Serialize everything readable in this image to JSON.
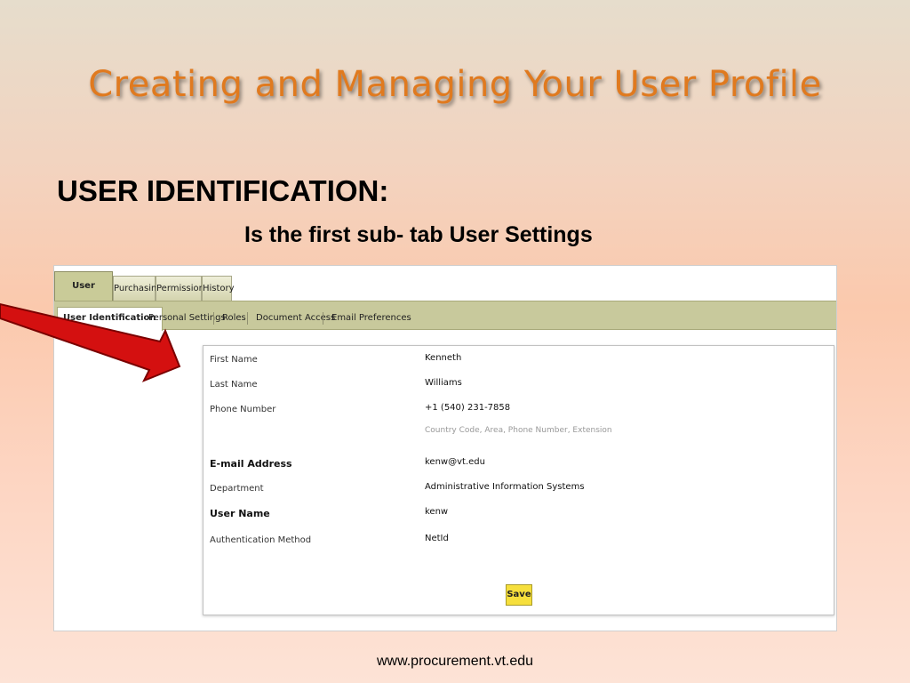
{
  "slide": {
    "title": "Creating and Managing Your User Profile",
    "heading": "USER IDENTIFICATION:",
    "subheading": "Is the first sub- tab User Settings",
    "footer": "www.procurement.vt.edu"
  },
  "top_tabs": [
    "User Settings",
    "Purchasing",
    "Permissions",
    "History"
  ],
  "sub_tabs": [
    "User Identification",
    "Personal Settings",
    "Roles",
    "Document Access",
    "Email Preferences"
  ],
  "form": {
    "first_name_label": "First Name",
    "first_name_value": "Kenneth",
    "last_name_label": "Last Name",
    "last_name_value": "Williams",
    "phone_label": "Phone Number",
    "phone_value": "+1 (540) 231-7858",
    "phone_hint": "Country Code, Area, Phone Number, Extension",
    "email_label": "E-mail Address",
    "email_value": "kenw@vt.edu",
    "department_label": "Department",
    "department_value": "Administrative Information Systems",
    "username_label": "User Name",
    "username_value": "kenw",
    "auth_label": "Authentication Method",
    "auth_value": "NetId",
    "save_label": "Save"
  },
  "colors": {
    "title": "#e07a1f",
    "arrow": "#d41010",
    "tab_bar": "#c8c99c",
    "save_button": "#f6df3c"
  }
}
